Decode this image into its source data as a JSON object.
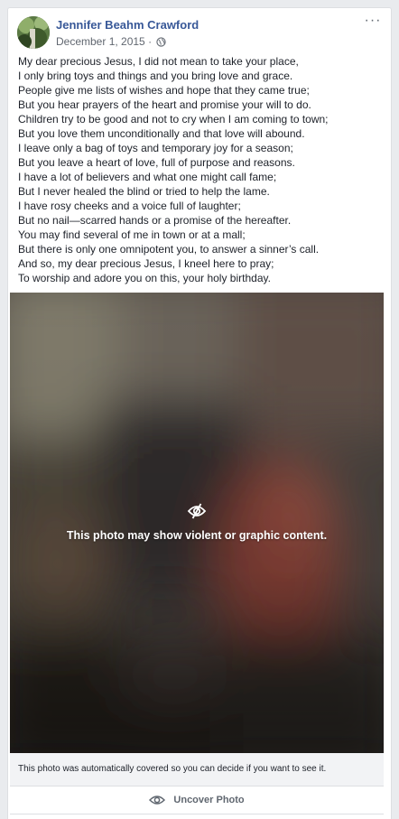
{
  "post": {
    "author": "Jennifer Beahm Crawford",
    "date": "December 1, 2015",
    "separator": "·",
    "privacy_icon": "globe-icon",
    "more_icon": "more-options-icon",
    "more_label": "···",
    "poem_lines": [
      "My dear precious Jesus, I did not mean to take your place,",
      "I only bring toys and things and you bring love and grace.",
      "People give me lists of wishes and hope that they came true;",
      "But you hear prayers of the heart and promise your will to do.",
      "Children try to be good and not to cry when I am coming to town;",
      "But you love them unconditionally and that love will abound.",
      "I leave only a bag of toys and temporary joy for a season;",
      "But you leave a heart of love, full of purpose and reasons.",
      "I have a lot of believers and what one might call fame;",
      "But I never healed the blind or tried to help the lame.",
      "I have rosy cheeks and a voice full of laughter;",
      "But no nail—scarred hands or a promise of the hereafter.",
      "You may find several of me in town or at a mall;",
      "But there is only one omnipotent you, to answer a sinner’s call.",
      "And so, my dear precious Jesus, I kneel here to pray;",
      "To worship and adore you on this, your holy birthday."
    ]
  },
  "photo": {
    "warning_icon": "eye-slash-icon",
    "warning_text": "This photo may show violent or graphic content.",
    "caption": "This photo was automatically covered so you can decide if you want to see it.",
    "uncover_icon": "eye-icon",
    "uncover_label": "Uncover Photo"
  },
  "colors": {
    "link": "#385898",
    "secondary_text": "#616770",
    "page_bg": "#e9ebee",
    "caption_bg": "#f2f3f5"
  }
}
